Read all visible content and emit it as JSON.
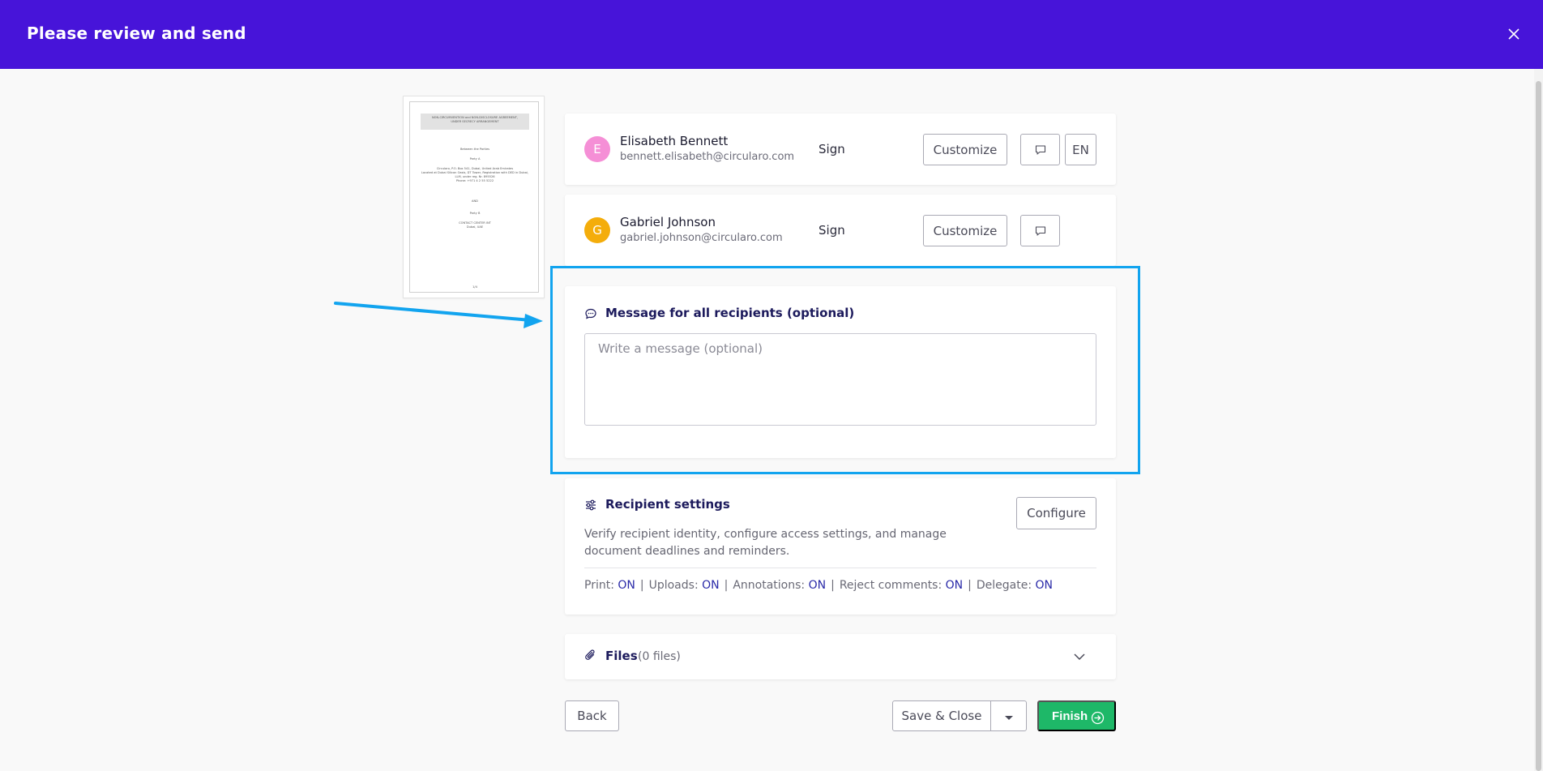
{
  "header": {
    "title": "Please review and send"
  },
  "document": {
    "thumbnail_lines": [
      "NON-CIRCUMVENTION and NON-DISCLOSURE AGREEMENT,",
      "UNDER SECRECY ARRANGEMENT",
      "Between the Parties",
      "Party A",
      "Circularo, P.O. Box 541, Dubai, United Arab Emirates",
      "Located at Dubai Silicon Oasis, DT Tower, Registration with DED in Dubai,",
      "LLM, under reg. Nr. 895526",
      "Phone: +971 4 2 55 5222",
      "AND",
      "Party B",
      "CONTACT CENTER INT",
      "Dubai, UAE",
      "1/4"
    ]
  },
  "recipients": [
    {
      "initial": "E",
      "name": "Elisabeth Bennett",
      "email": "bennett.elisabeth@circularo.com",
      "role": "Sign",
      "customize_label": "Customize",
      "language": "EN",
      "avatar_color": "#f58fd6"
    },
    {
      "initial": "G",
      "name": "Gabriel Johnson",
      "email": "gabriel.johnson@circularo.com",
      "role": "Sign",
      "customize_label": "Customize",
      "avatar_color": "#f4ad0b"
    }
  ],
  "message": {
    "title": "Message for all recipients (optional)",
    "placeholder": "Write a message (optional)"
  },
  "settings": {
    "title": "Recipient settings",
    "description": "Verify recipient identity, configure access settings, and manage document deadlines and reminders.",
    "configure_label": "Configure",
    "items": [
      {
        "label": "Print:",
        "value": "ON"
      },
      {
        "label": "Uploads:",
        "value": "ON"
      },
      {
        "label": "Annotations:",
        "value": "ON"
      },
      {
        "label": "Reject comments:",
        "value": "ON"
      },
      {
        "label": "Delegate:",
        "value": "ON"
      }
    ]
  },
  "files": {
    "title": "Files",
    "count": "(0 files)"
  },
  "footer": {
    "back_label": "Back",
    "save_close_label": "Save & Close",
    "finish_label": "Finish"
  },
  "colors": {
    "header_bg": "#4714d9",
    "highlight": "#12a4ef",
    "finish_bg": "#1eb868",
    "on_value": "#2a2aa8"
  }
}
